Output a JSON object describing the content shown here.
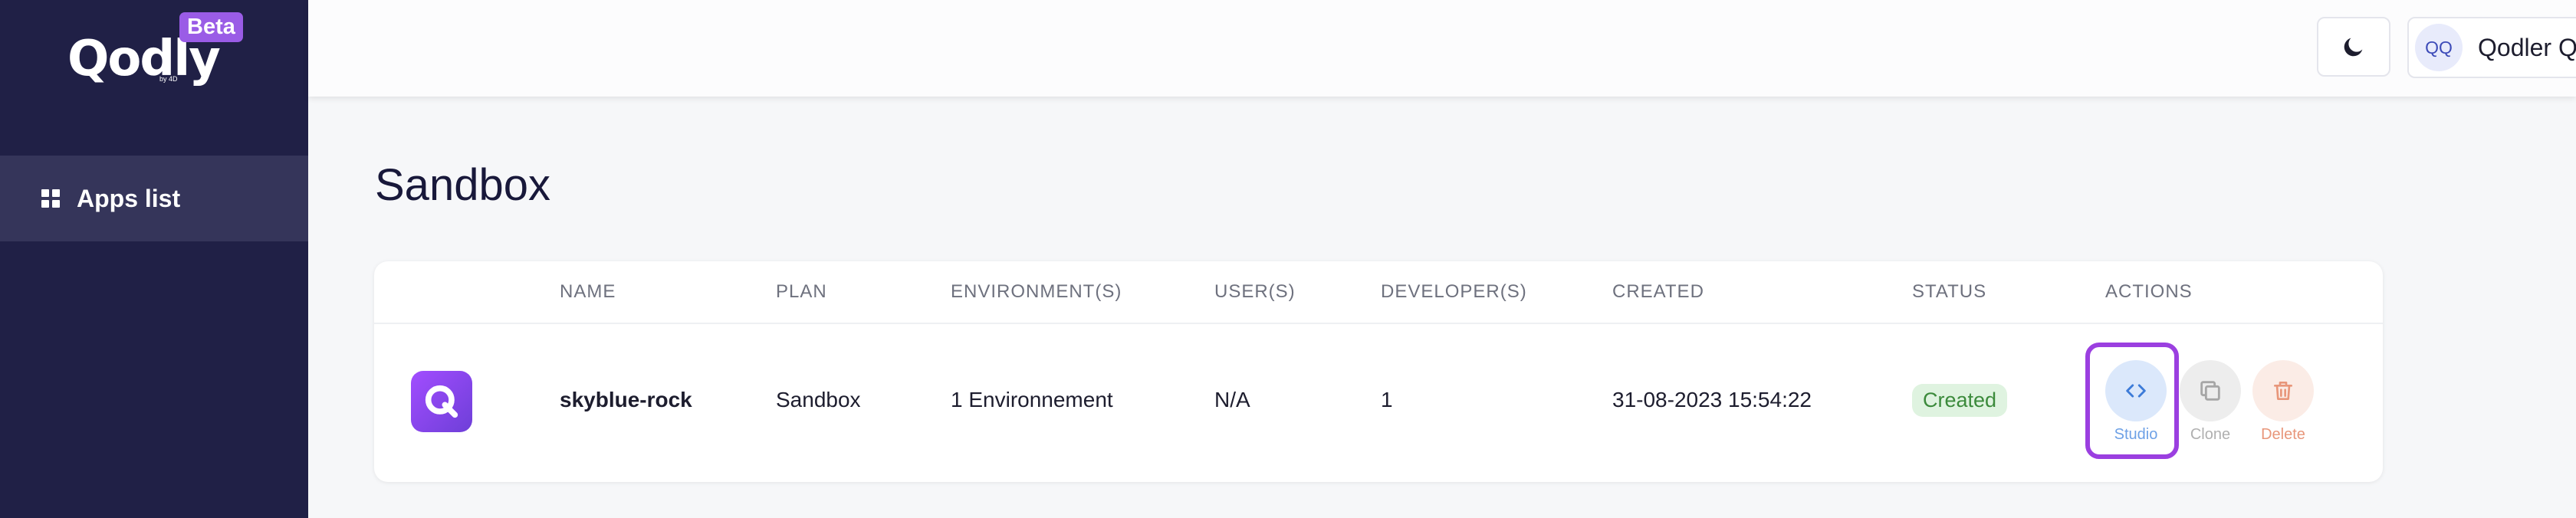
{
  "brand": {
    "logo_text": "Qodly",
    "logo_by": "by 4D",
    "badge": "Beta"
  },
  "sidebar": {
    "items": [
      {
        "label": "Apps list",
        "icon": "grid-icon",
        "active": true
      }
    ]
  },
  "header": {
    "theme_icon": "moon-icon",
    "user": {
      "initials": "QQ",
      "name": "Qodler Qodly",
      "chevron": "chevron-down-icon"
    }
  },
  "page": {
    "title": "Sandbox"
  },
  "table": {
    "columns": [
      "NAME",
      "PLAN",
      "ENVIRONMENT(S)",
      "USER(S)",
      "DEVELOPER(S)",
      "CREATED",
      "STATUS",
      "ACTIONS"
    ],
    "rows": [
      {
        "name": "skyblue-rock",
        "plan": "Sandbox",
        "environments": "1 Environnement",
        "users": "N/A",
        "developers": "1",
        "created": "31-08-2023 15:54:22",
        "status": "Created",
        "actions": {
          "studio": "Studio",
          "clone": "Clone",
          "delete": "Delete"
        }
      }
    ]
  },
  "colors": {
    "sidebar": "#202046",
    "active_nav": "#35355a",
    "status_bg": "#dff3e0",
    "status_text": "#3b8a3b",
    "studio": "#3d7bd8",
    "highlight": "#9b3fe0",
    "delete": "#e8967a"
  }
}
